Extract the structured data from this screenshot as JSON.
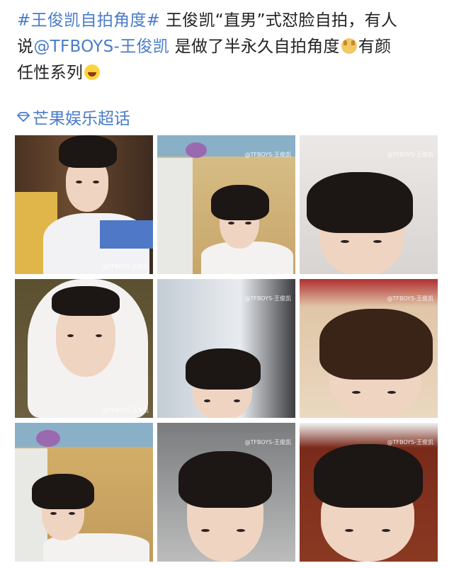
{
  "post": {
    "hashtag": "#王俊凯自拍角度#",
    "line1_text": " 王俊凯“直男”式怼脸自拍，有人",
    "line2_prefix": "说",
    "mention": "@TFBOYS-王俊凯",
    "line2_text": " 是做了半永久自拍角度",
    "line2_suffix": "有颜",
    "line3_text": "任性系列",
    "emoji_1": "doge-emoji",
    "emoji_2": "laugh-cry-emoji",
    "topic_label": "芒果娱乐超话",
    "link_color": "#4a7cc9"
  },
  "photos": [
    {
      "watermark": "@TFBOYS-王俊凯"
    },
    {
      "watermark": "@TFBOYS-王俊凯"
    },
    {
      "watermark": "@TFBOYS-王俊凯"
    },
    {
      "watermark": "@TFBOYS-王俊凯"
    },
    {
      "watermark": "@TFBOYS-王俊凯"
    },
    {
      "watermark": "@TFBOYS-王俊凯"
    },
    {
      "watermark": ""
    },
    {
      "watermark": "@TFBOYS-王俊凯"
    },
    {
      "watermark": "@TFBOYS-王俊凯"
    }
  ]
}
